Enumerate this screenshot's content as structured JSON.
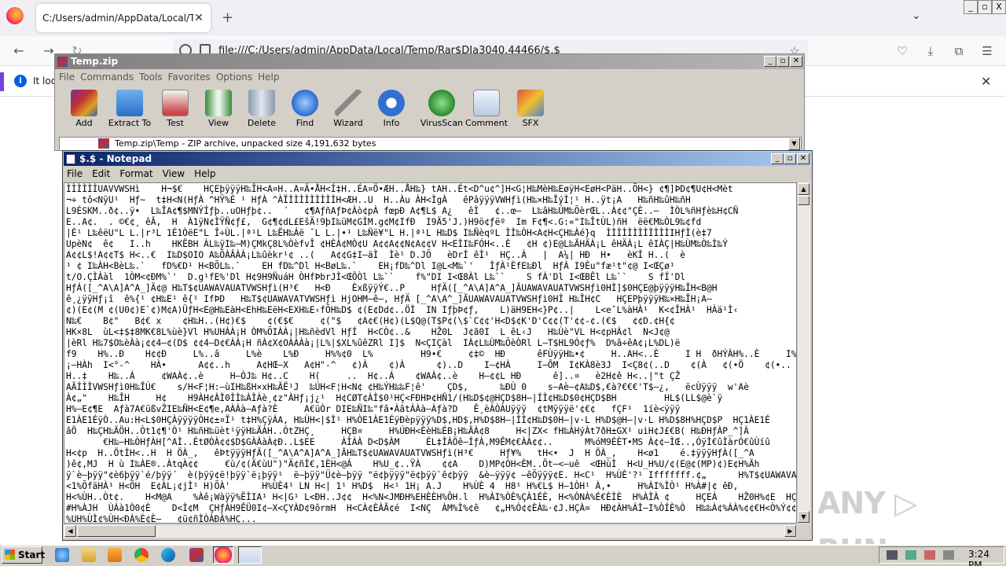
{
  "firefox": {
    "tab_title": "C:/Users/admin/AppData/Local/Temp/Ra",
    "new_tab": "+",
    "url": "file:///C:/Users/admin/AppData/Local/Temp/Rar$DIa3040.44466/$.$",
    "notification_text": "It loo",
    "win_controls": [
      "_",
      "▫",
      "X"
    ]
  },
  "winrar": {
    "title": "Temp.zip",
    "menu": [
      "File",
      "Commands",
      "Tools",
      "Favorites",
      "Options",
      "Help"
    ],
    "toolbar": [
      {
        "label": "Add",
        "icon": "add-archive-icon"
      },
      {
        "label": "Extract To",
        "icon": "folder-icon"
      },
      {
        "label": "Test",
        "icon": "test-clipboard-icon"
      },
      {
        "label": "View",
        "icon": "book-icon"
      },
      {
        "label": "Delete",
        "icon": "trash-icon"
      },
      {
        "label": "Find",
        "icon": "magnifier-icon"
      },
      {
        "label": "Wizard",
        "icon": "wand-icon"
      },
      {
        "label": "Info",
        "icon": "info-icon"
      },
      {
        "label": "VirusScan",
        "icon": "virus-icon"
      },
      {
        "label": "Comment",
        "icon": "comment-icon"
      },
      {
        "label": "SFX",
        "icon": "sfx-box-icon"
      }
    ],
    "address": "Temp.zip\\Temp - ZIP archive, unpacked size 4,191,632 bytes"
  },
  "notepad": {
    "title": "$.$ - Notepad",
    "menu": [
      "File",
      "Edit",
      "Format",
      "View",
      "Help"
    ],
    "content": "ÌÌÌÌÌÌUAVVWSHì    H¬$€    HÇEþÿÿÿH‰ÎH<A¤H..A¤Ä•ÅH<Í‡H..ÉA¤Ö•ÆH..ÅH‰} tAH..Ét<D^u¢^]H<G¦H‰MèH‰EøÿH<EøH<PäH..ÕH<} ¢¶]ÞD¢¶U¢H<Mèt\n¬÷ tô<NÿU¹  Hƒ~  t‡H<N(HƒÀ ^HŸ%É ¹ HƒÀ ^ÀÏÌÌÌÌÌÌÌÌÌH<ÆH..U  H..Àu ÀH<ÌgÀ   êPâÿÿÿVWHƒì(H‰×H‰ÎýÌ¦¹ H..ÿt¡A   H‰ñH‰ûH‰ñH\nL9ÉSKM..ð¢..ÿ•  L‰ÎA¢¶$MNÝÍƒþ..uOHƒþ¢..  ´   ¢¶AƒñAƒÞ¢Àò¢pÀ fœpÐ A¢¶L$ A¿   êÌ   ¢..œ–  L‰âH‰ÚM‰ÕèrŒL..À¢¢\"ÇÈ..–  ÌÒL%ñHƒè‰H¢CÑ\nE..A¢.  . ©€¢¸ êÂ,  H  À1ÿN¢ÌŸÑ¢ƒ£,  G¢¶¢dL£EšÄ!9þI‰üM¢GÌM.g¢M¢IfÐ  I9Ä5'J.)H9ö¢ƒëº  Im F¢¶<.G:«\"I‰ÎtÙL)ñH  ëë€M‰ÒL9‰¢fd\n|É¹ L‰êëU\"L L.|r³L 1É1ÒëE\"L Î÷ÙL.|ª¹L L‰ËH‰Áë ¯L L.|•¹ L‰Ñë¥\"L H.|ª¹L H‰D$ I‰ÑèqºL ÌÌ‰ÒH<A¢H<ÇH‰Àé}q  ÌÌÌÌÌÌÌÌÌÌÌÌIHƒÌ(è‡7\nUpèN¢  ê¢   I..h    HKËBH ÀL‰ÿI‰–M)ÇMkÇ8L%ÒèfvÎ ¢HÈÀ¢MÒ¢U A¢¢A¢¢N¢A¢¢V H<EÌI‰FÓH<..È   ¢H ¢)E@L‰ÃHÄÀ¡L êHÄÀ¡L êIÀÇ|H‰ÙM‰Ò‰Ì‰Ý\nA¢¢L$!A¢¢T$ H<..€  I‰D$OIO A‰ÕÀÂÀÀ¡L‰ûèkr¹¢ ..(   A¢¢G‡I–äÌ  Ìè¹ D.JÕ   èDrÍ êÌ¹  HÇ..À   |  A¼| HÐ  H•   èKÍ H..(  è\n¹ ¢ I‰ÀH<BèL‰.`   fD%€D¹ H<BÕL‰.`    EH fD‰^Dl H<BøL‰.`    EH¡fD‰^Dl I@L<M‰`'   ÌƒÀ¹ÈfE‰Ðl  HƒÀ I9Èu\"fæ¹t\"¢@ I<ŒÇø¹ \nt/O.ÇÌÀàl  1ÒM<¢ÐM%`'  D.g¹fE%'Dl H¢9H9ÑuáH ÒHfÞbrJÌ<ŒÖÒl L‰``    f%\"DI I<Œ8Àl L‰``    S fÁ'Dl I<ŒBÊl L‰``    S fÍ'Dl\nHƒÁ([_^A\\A]A^A_]Ä¢@ H‰T$¢UAWAVAUATVWSHƒì(H³€   H<Ð    ÈxßÿÿÝ€..P     HƒÄ([_^A\\A]A^A_]ÃUAWAVAUATVWSHƒì0HÌ]$0HÇE@þÿÿÿH‰ÎH<B@H\nê¸¿ÿÿHƒ¡î  ê%{¹ ¢H‰E¹ ê{¹ IfÞD   H‰T$¢UAWAVATVWSHƒì HjOHM–ê–, HƒÄ [_^A\\A^_]ÃUAWAVAUATVWSHƒì0HÌ H‰ÎH¢C   HÇEPþÿÿÿH‰×H‰ÎH¡A–\n¢)(E¢(M ¢(U0¢)E`¢)M¢A)ÜƒH<E@H‰EàH<EhH‰EëH<EXH‰E‹fÕH‰D$ ¢(E¢Dd¢..ÖÌ  IN IƒþÞ¢ƒ,    L)äH9EH<}P¢..|    L<eˆL%àHÀ¹  K<¢ÎHÀ¹  HÀä¹Ì‹\nN‰€    B¢\"   B¢€ x    ¢H‰H..(H¢)€$    ¢(€$€     ¢(\"$   ¢A¢€(H¢)(L$Q@(T$P¢(\\$`C¢¢'H<D$¢K'D'C¢¢(T'¢¢-¢.(€$   ¢¢D.¢H{¢\nHK×8L  ùL<‡$‡8MK€8L%ùè}Vl H%UHÀÀ¡H ÒM%ÕIÀÀ¡|H‰ñèdVl HƒÍ  H<CÒ¢..&    HŽ0L  J¢ã0I  L êL‹J   H‰Ùè\"VL H<¢pHÀ¢l  N<J¢@\n|èRl H‰7$O‰èÀà¡¢¢4–¢(D$ ¢¢4–D¢€ÀÀ¡H ñÀ¢X¢OÀÀÀà¡|L%|$XL%ûêZRl I]$  N<ÇIÇàl  IÀ¢L‰ÙM‰ÕèÒRl L–T$HL9Ó¢ƒ%  D%â÷êA¢¡L%DL)ë\nf9    H%..Ð    H¢¢Ð     L%..â     L%è    L%Ð     H%%¢0  L%         H9•€     ¢‡©  HÐ      êFÙÿÿH‰•¢     H..AH<..È     I H  ðHÝÀH%..È     I%È€<°     M..ö\n¡–HÀh  I<°-^    HÀ•      A¢¢..h     A¢HŒ–X   A¢H\"-^   ¢)À    ¢)À      ¢)..D    I–¢HÀ     I–ŌM  I¢KÀ8è3J  I<Ç8¢(..D    ¢(À   ¢(•Ö    ¢(•..\nH..‡    H‰..Á     ¢WAÀ¢..è     H–ÒJ‰ H¢..C    H(     ..  H¢..Á    ¢WAÀ¢..è    H–¢¢L HÐ      ê]..¤   è2H¢ê H<..|\"t ÇŽ\nAÃÌÌÌVWSHƒì0H‰ÎÚ€    s/H<F¦H:–ùIH‰ßH×xH‰ÃË¹J  ‰ÚH<F¦H<N¢ ¢H‰ÝH‰‰F¦ê'    ÇD$,      ‰ÐÙ 0    s–Aè–¢A‰D$,€à?€€€'T$–¿,   ëcÙÿÿÿ  w'Aè\nÀ¢„\"    H‰ÎH     H¢    H9ÀH¢ÀÌ0ÌÌ‰ÀÌÀè¸¢z\"ÀHƒ¡j¿¹  H¢CØT¢ÀÌ$0¹HÇ<FÐHÞ¢HÑ1/(H‰D$¢@HÇD$8H–|ÍÌ¢H‰D$0¢HÇD$BH         HL$(LL$@è`ÿ\nH%–E¢¶E  Aƒà7A€üßvŽIE‰ÑH<E¢¶e,AÀÀà–Aƒà?È     A€üÒr DIE‰ÑI‰\"fâ•ÀâtÀÀà–Àƒà?D   Ê¸èÀÒÀUÿÿÿ  ¢tMÿÿÿë'¢€¢   fÇF¹  1íè<ÿÿÿ\nE1ÀE1ÉÿÒ..Au:H<L$0HÇÀÿÿÿÿÒH¢±¤Ï¹ t‡H%ÇÿÁA‚ H‰ÙH<|$Ì¹ H%ÒE1ÀE1ÉÿÐèpÿÿÿ%D$,HD$,H%D$8H–|ÍÌ¢H‰D$0H–|v·L H%D$@H–|v·L H%D$8H%HÇD$P  HÇ1ÀE1É\nâÖ  H‰ÇH‰ÃÖH..Òt1¢¶'Ò¹ H‰ñH‰üèt¹ÿÿH‰ÃÀH..ÒtZHÇ¸     HÇB¤     H%ÚÐH<ÈèH‰ÉB¡H‰ÃÀ¢8     H<|ZX< fH‰ÀHýÀt7ðH±GX¹ uiH¢J£€B( H‰ÐHƒÀP_^]À\n       €H‰–H‰ÒHƒÀH[^AÌ..ÉtØÒÀ¢¢$D$GÀÀàÀ¢Ð..L$EE     ÀÌÀÀ D<D$ÀM     ÉL‡ÌÀÖê–ÍƒÀ,M9ÊM¢€ÀÀ¢¢..      M%óM9ÉÈT•MS À¢¢–ÌŒ..,ÓÿÌ€ûÌàrÓ€ûÙíû\nH<¢p  H..ÖtÌH<..H  H ÖÀ_,   êÞtÿÿÿHƒÄ([_^A\\A^A]A^A_]ÃH‰T$¢UAWAVAUATVWSHƒì(H³€     Hƒ¥%   tH<•  J  H ÖÀ_,    H<ø1    é.‡ÿÿÿHƒÀ([_^A\n)ê¢,MJ  H ù I‰ÀE®..ÀtqÀ¢¢     €ù/¢(Ä€ùU\")\"Ä¢ñÌ€,1ÈH<@Á    H%U_¢..ŸÀ    ¢¢A    D)MP¢ÓH<ÈM..Öt–<–uê  <ŒHùÌ  H<U_H%U/¢(E@¢(MP)¢)E¢H%Ãh\nÿ`è–þÿÿ\"¢è6þÿÿ`é/þÿÿ´  è(þÿÿ¢ë!þÿÿ`ë¡þÿÿ¹  ë–þÿÿ\"Ü¢è–þÿÿ \"ë¢þÿÿÿ\"ë¢þÿÿ`ê¢þÿÿ  &è–ÿÿÿ¢ –êÕÿÿÿ¢E. H<C¹  H%ÙÈ'?¹ Ifffffff.¢„      H%T$¢UAWAVAI\n<1%ÕfäHÀ¹ H<ÕH  E¢ÀL¡¢jÌ¹ H)ÕÀ'      H%ÙÈ4¹ LN H<| 1¹ H%D$  H<¹ 1H¡ A.J    H%ÙÈ 4  H8¹ H%€L$ H–1ÒH¹ À,•     H%ÀI%ÌÒ¹ H%À#|¢ êÐ,\nH<%ÙH..Òt¢.    H<M@A    %Àê¡Wàÿÿ%ËÌIA¹ H<|G¹ L<ÐH..J¢¢  H<%N<JMÐH%EHÈÈH%ÔH.l  H%ÀI%ÒÈ%ÇÀ1ÉÈ, H<%ÒNÀ%É€ÈÌÈ  H%ÀÌÀ ¢     HÇEÀ    HŽ0H%¢E  HÇE\n#H%ÀJH  ÙÀà1Ò0¢È    D<Ì¢M  ÇHƒÀH9ÊÜ0I¢–X<ÇYÀD¢9ôrmH  H<CÀ¢ÈÀÃ¢é  I<NÇ  ÀM%Ì%¢ê   ¢„H%Ò¢¢ÈÀ‰·¢J.HÇÀ=  HÐ¢ÀH%ÀÌ–I%ÒÍÈ%Ò  H‰‰À¢%ÀÀ%¢¢€H<Ò%Ý¢¢\n%UH%ÙÌ¢%ÙH<ÐÀ%È¢È–   ¢ü¢ñÌÒÀÐÀ%HÇ...\n¢  H‰EÀH%ÈE@HÀèeq.ÿÿÿE@ÿF¡ HMÒÈ%ÌÀÀÀ  H%%ÓÀÈ%É%ÇÀÈÈ  ,HÀ¢ÀÀÀÈ%ÒÈ%¢ÀÀ  H%¡ÀÌÀ¢¢      ¢ƒ¢ÖL  H¢‹ÇH%ÐL  ÈÈÈ  H%ÐH‰EÀ\n H%D$(1ÿL%aL)ØH  HÓfø  r°M%åL%¿p%ø@'|$'L%|$hL%L%T$01ÿLt$HL|$pH–L L%d$@L9îu4M9âu/L%ñH%Àè¥¡   H¢|$H ¢..¢.   H¢|$P ¢..@¢.   L%"
  }
}
